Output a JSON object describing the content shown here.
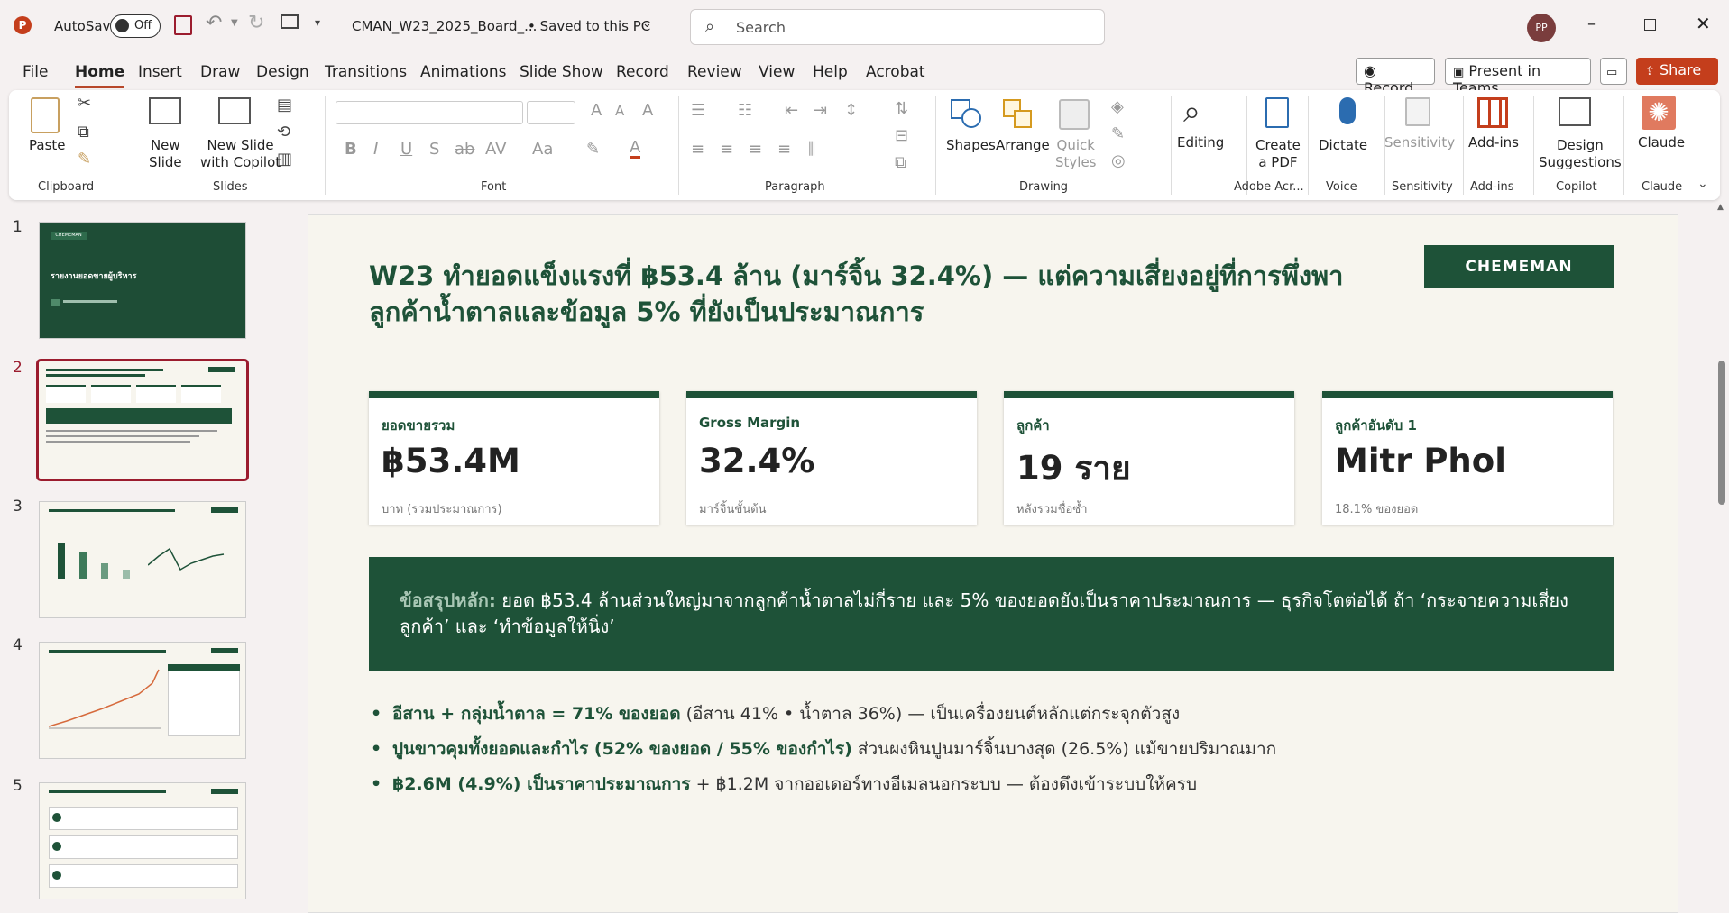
{
  "titlebar": {
    "autosave_label": "AutoSave",
    "autosave_state": "Off",
    "filename": "CMAN_W23_2025_Board_...",
    "save_status": "• Saved to this PC",
    "search_placeholder": "Search",
    "user_initials": "PP"
  },
  "menu": {
    "tabs": [
      "File",
      "Home",
      "Insert",
      "Draw",
      "Design",
      "Transitions",
      "Animations",
      "Slide Show",
      "Record",
      "Review",
      "View",
      "Help",
      "Acrobat"
    ],
    "active": "Home",
    "record": "Record",
    "present": "Present in Teams",
    "share": "Share"
  },
  "ribbon": {
    "clipboard": {
      "paste": "Paste",
      "group": "Clipboard"
    },
    "slides": {
      "new_slide_1": "New",
      "new_slide_2": "Slide",
      "copilot_1": "New Slide",
      "copilot_2": "with Copilot",
      "group": "Slides"
    },
    "font": {
      "group": "Font"
    },
    "paragraph": {
      "group": "Paragraph"
    },
    "drawing": {
      "shapes": "Shapes",
      "arrange": "Arrange",
      "quick_1": "Quick",
      "quick_2": "Styles",
      "group": "Drawing"
    },
    "editing": {
      "label": "Editing"
    },
    "adobe": {
      "create_1": "Create",
      "create_2": "a PDF",
      "group": "Adobe Acr..."
    },
    "voice": {
      "dictate": "Dictate",
      "group": "Voice"
    },
    "sensitivity": {
      "label": "Sensitivity",
      "group": "Sensitivity"
    },
    "addins": {
      "label": "Add-ins",
      "group": "Add-ins"
    },
    "copilot": {
      "design_1": "Design",
      "design_2": "Suggestions",
      "group": "Copilot"
    },
    "claude": {
      "label": "Claude",
      "group": "Claude"
    }
  },
  "thumbnails": {
    "numbers": [
      "1",
      "2",
      "3",
      "4",
      "5"
    ],
    "t1_title": "รายงานยอดขายผู้บริหาร",
    "t1_brand": "CHEMEMAN",
    "selected": 2
  },
  "slide": {
    "brand": "CHEMEMAN",
    "title": "W23 ทำยอดแข็งแรงที่ ฿53.4 ล้าน (มาร์จิ้น 32.4%) — แต่ความเสี่ยงอยู่ที่การพึ่งพาลูกค้าน้ำตาลและข้อมูล 5% ที่ยังเป็นประมาณการ",
    "kpis": [
      {
        "label": "ยอดขายรวม",
        "value": "฿53.4M",
        "sub": "บาท (รวมประมาณการ)"
      },
      {
        "label": "Gross Margin",
        "value": "32.4%",
        "sub": "มาร์จิ้นขั้นต้น"
      },
      {
        "label": "ลูกค้า",
        "value": "19 ราย",
        "sub": "หลังรวมชื่อซ้ำ"
      },
      {
        "label": "ลูกค้าอันดับ 1",
        "value": "Mitr Phol",
        "sub": "18.1% ของยอด"
      }
    ],
    "summary_lead": "ข้อสรุปหลัก:",
    "summary_text": "ยอด ฿53.4 ล้านส่วนใหญ่มาจากลูกค้าน้ำตาลไม่กี่ราย และ 5% ของยอดยังเป็นราคาประมาณการ — ธุรกิจโตต่อได้ ถ้า ‘กระจายความเสี่ยงลูกค้า’ และ ‘ทำข้อมูลให้นิ่ง’",
    "bullets": [
      {
        "strong": "อีสาน + กลุ่มน้ำตาล = 71% ของยอด",
        "rest": " (อีสาน 41% • น้ำตาล 36%) — เป็นเครื่องยนต์หลักแต่กระจุกตัวสูง"
      },
      {
        "strong": "ปูนขาวคุมทั้งยอดและกำไร (52% ของยอด / 55% ของกำไร)",
        "rest": " ส่วนผงหินปูนมาร์จิ้นบางสุด (26.5%) แม้ขายปริมาณมาก"
      },
      {
        "strong": "฿2.6M (4.9%) เป็นราคาประมาณการ",
        "rest": " + ฿1.2M จากออเดอร์ทางอีเมลนอกระบบ — ต้องดึงเข้าระบบให้ครบ"
      }
    ]
  },
  "colors": {
    "brand_green": "#1e5238",
    "accent_red": "#c43e1c",
    "selected_border": "#9b1c2e"
  }
}
